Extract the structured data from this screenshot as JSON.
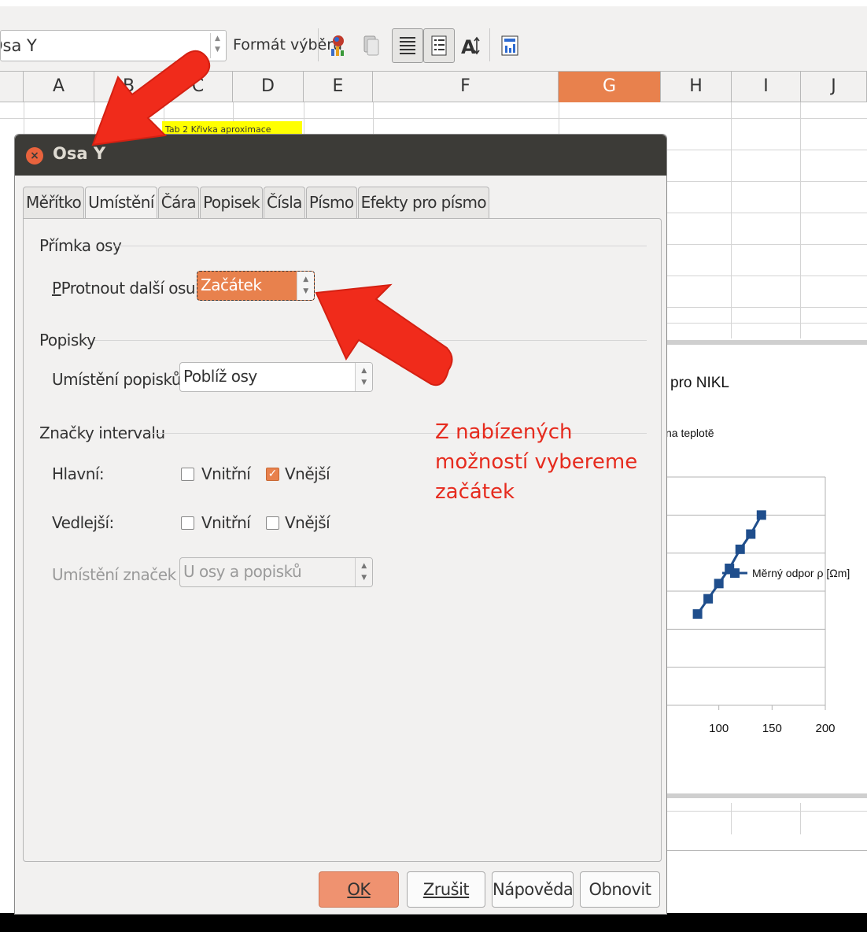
{
  "toolbar": {
    "namebox_value": "Osa Y",
    "format_selection_label": "Formát výběru"
  },
  "columns": [
    "A",
    "B",
    "C",
    "D",
    "E",
    "F",
    "G",
    "H",
    "I",
    "J"
  ],
  "active_column": "G",
  "yellow_cell_text": "Tab 2 Křivka aproximace",
  "chart_data": {
    "type": "scatter",
    "title": "pro NIKL",
    "subtitle": "na teplotě",
    "x_tick_labels": [
      "100",
      "150",
      "200"
    ],
    "legend": "Měrný odpor ρ  [Ωm]",
    "legend_position": "right",
    "series": [
      {
        "name": "Měrný odpor ρ  [Ωm]",
        "x": [
          80,
          90,
          100,
          110,
          120,
          130,
          140
        ],
        "y": [
          0.24,
          0.28,
          0.32,
          0.36,
          0.41,
          0.45,
          0.5
        ]
      }
    ],
    "colors": {
      "series": "#1f4e8c"
    }
  },
  "dialog": {
    "title": "Osa Y",
    "tabs": [
      "Měřítko",
      "Umístění",
      "Čára",
      "Popisek",
      "Čísla",
      "Písmo",
      "Efekty pro písmo"
    ],
    "active_tab": "Umístění",
    "section_axis_line": "Přímka osy",
    "cross_other_axis_label": "Protnout další osu v",
    "cross_other_axis_value": "Začátek",
    "section_labels": "Popisky",
    "label_position_label": "Umístění popisků",
    "label_position_value": "Poblíž osy",
    "section_interval_marks": "Značky intervalu",
    "major_label": "Hlavní:",
    "minor_label": "Vedlejší:",
    "inner_label": "Vnitřní",
    "outer_label": "Vnější",
    "major_inner_checked": false,
    "major_outer_checked": true,
    "minor_inner_checked": false,
    "minor_outer_checked": false,
    "mark_placement_label": "Umístění značek",
    "mark_placement_value": "U osy a popisků",
    "buttons": {
      "ok": "OK",
      "cancel": "Zrušit",
      "help": "Nápověda",
      "reset": "Obnovit"
    }
  },
  "annotation": {
    "note": "Z nabízených možností vybereme začátek",
    "color": "#e62b1e"
  }
}
